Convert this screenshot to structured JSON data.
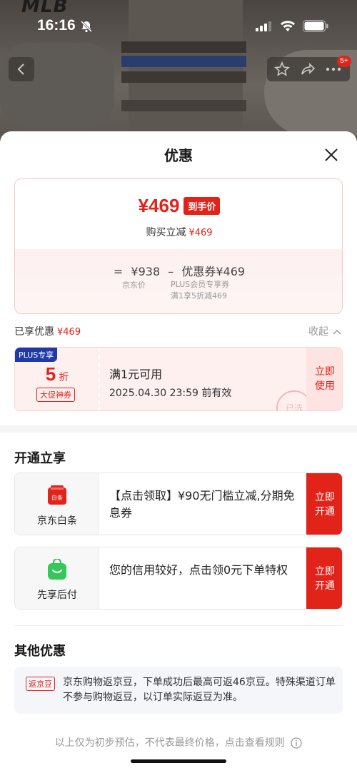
{
  "status": {
    "time": "16:16"
  },
  "background": {
    "logo": "MLB",
    "cart_badge": "5+"
  },
  "sheet": {
    "title": "优惠",
    "price": {
      "amount": "¥469",
      "tag": "到手价",
      "sub_label": "购买立减",
      "sub_amount": "¥469"
    },
    "formula": {
      "eq": "=",
      "jd_price": "¥938",
      "minus": "–",
      "coupon_value": "优惠券¥469",
      "jd_price_label": "京东价",
      "coupon_label_1": "PLUS会员专享券",
      "coupon_label_2": "满1享5折减469"
    },
    "enjoyed": {
      "label": "已享优惠",
      "amount": "¥469",
      "collapse": "收起"
    },
    "coupon": {
      "plus_tag": "PLUS专享",
      "discount": "5",
      "discount_unit": "折",
      "promo_tag": "大促神券",
      "condition": "满1元可用",
      "expiry": "2025.04.30 23:59 前有效",
      "use_line1": "立即",
      "use_line2": "使用",
      "stamp": "已选"
    },
    "open_section": {
      "title": "开通立享",
      "cards": [
        {
          "icon": "jd-baitiao-icon",
          "icon_text": "白条",
          "label": "京东白条",
          "desc": "【点击领取】¥90无门槛立减,分期免息券",
          "btn1": "立即",
          "btn2": "开通"
        },
        {
          "icon": "shopping-bag-icon",
          "label": "先享后付",
          "desc": "您的信用较好，点击领0元下单特权",
          "btn1": "立即",
          "btn2": "开通"
        }
      ]
    },
    "other_section": {
      "title": "其他优惠",
      "tag": "返京豆",
      "text": "京东购物返京豆，下单成功后最高可返46京豆。特殊渠道订单不参与购物返豆，以订单实际返豆为准。"
    },
    "footer": "以上仅为初步预估，不代表最终价格，点击查看规则"
  },
  "colors": {
    "accent": "#e2231a",
    "plus_blue": "#1f3aa8",
    "baitiao_green": "#34c759"
  }
}
